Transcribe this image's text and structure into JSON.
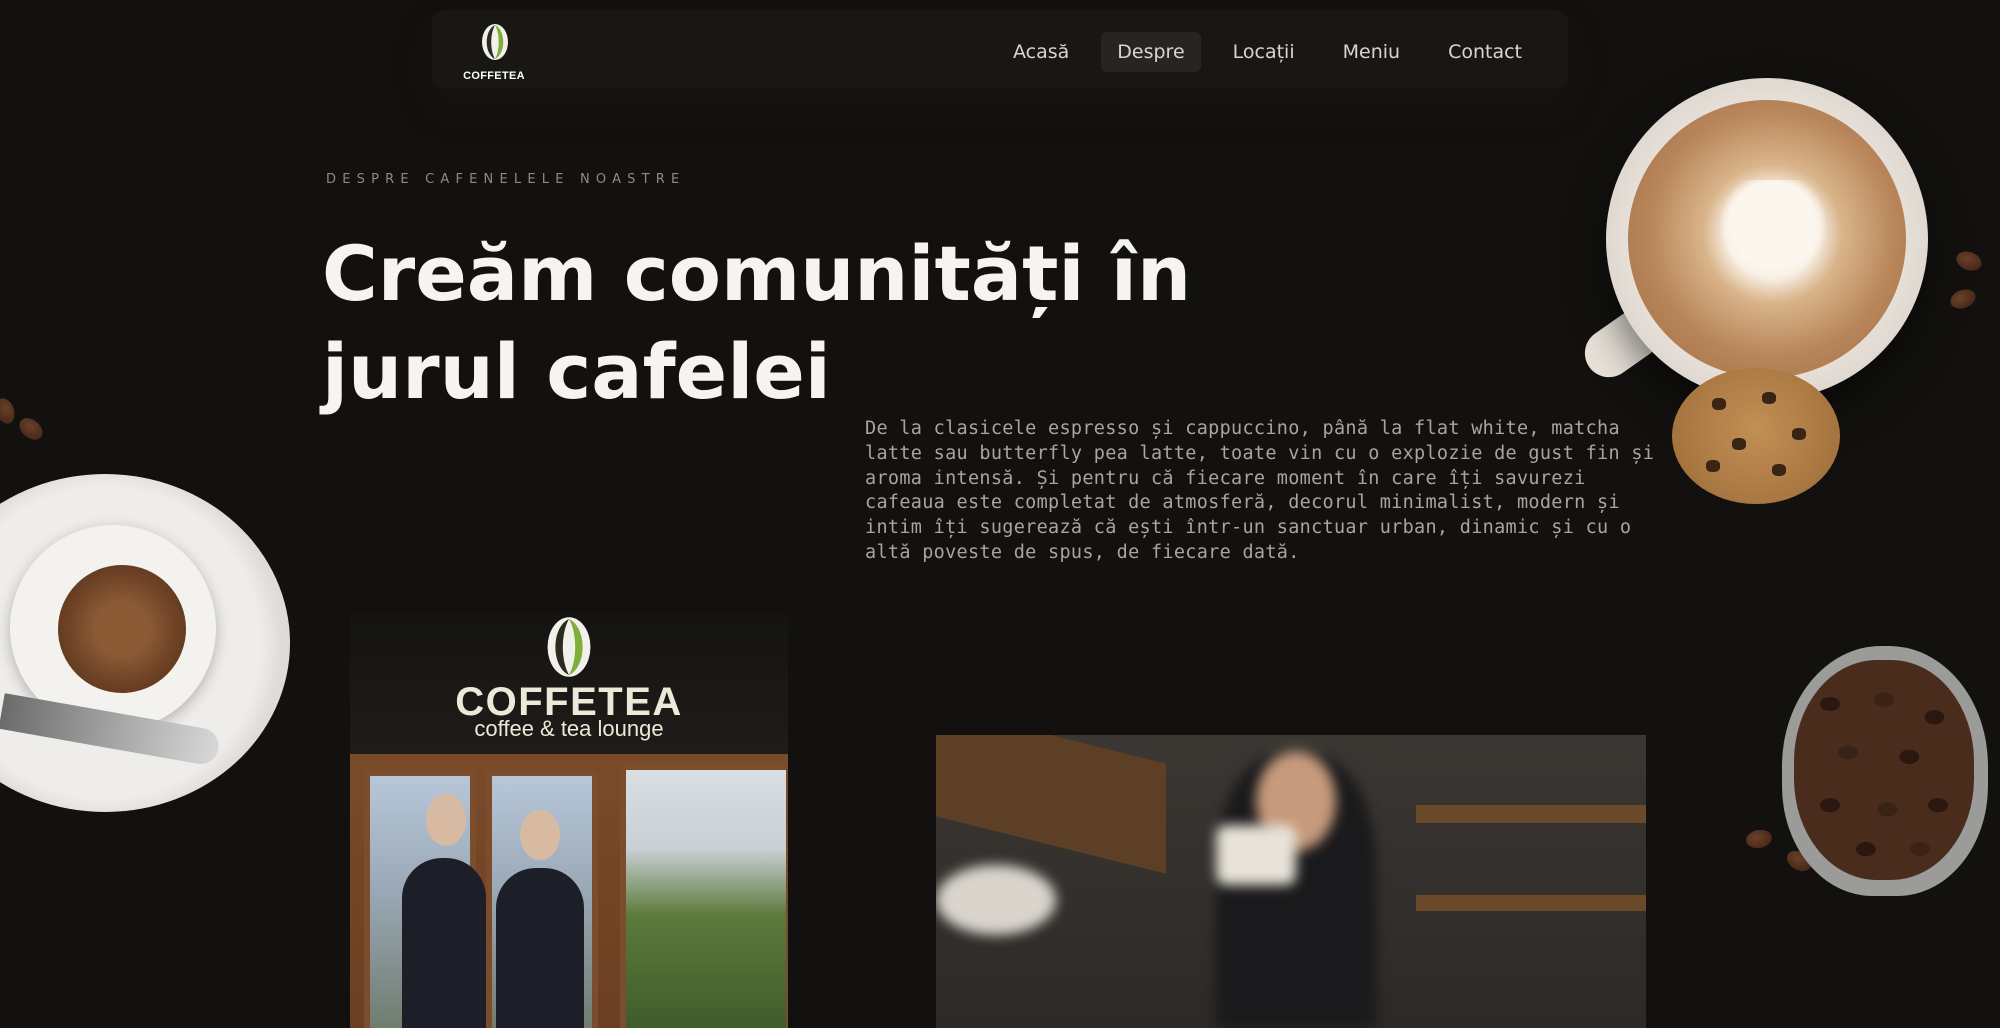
{
  "brand": {
    "logo_text": "COFFETEA"
  },
  "nav": {
    "items": [
      {
        "label": "Acasă",
        "active": false
      },
      {
        "label": "Despre",
        "active": true
      },
      {
        "label": "Locații",
        "active": false
      },
      {
        "label": "Meniu",
        "active": false
      },
      {
        "label": "Contact",
        "active": false
      }
    ]
  },
  "hero": {
    "eyebrow": "DESPRE CAFENELELE NOASTRE",
    "headline_line1": "Creăm comunități în",
    "headline_line2": "jurul cafelei",
    "description": "De la clasicele espresso și cappuccino, până la flat white, matcha latte sau butterfly pea latte, toate vin cu o explozie de gust fin și aroma intensă. Și pentru că fiecare moment în care îți savurezi cafeaua este completat de atmosferă, decorul minimalist, modern și intim îți sugerează că ești într-un sanctuar urban, dinamic și cu o altă poveste de spus, de fiecare dată."
  },
  "photos": {
    "store_sign_title": "COFFETEA",
    "store_sign_subtitle": "coffee & tea lounge"
  },
  "colors": {
    "background": "#12110f",
    "navbar": "#181714",
    "active_nav": "#262521",
    "bean_green": "#7fae3a",
    "bean_dark": "#2a2a1f"
  },
  "icons": {
    "logo": "coffee-bean-icon"
  }
}
